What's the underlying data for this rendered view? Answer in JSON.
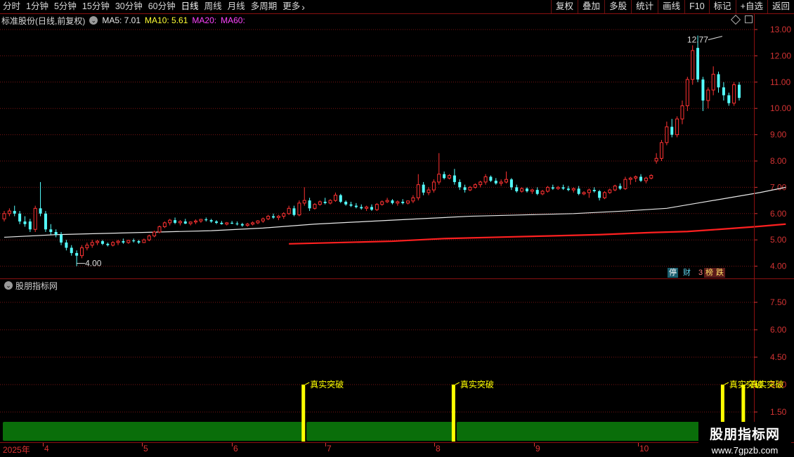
{
  "toolbar": {
    "periods": [
      "分时",
      "1分钟",
      "5分钟",
      "15分钟",
      "30分钟",
      "60分钟",
      "日线",
      "周线",
      "月线",
      "多周期",
      "更多"
    ],
    "active_period": "日线",
    "right_buttons": [
      "复权",
      "叠加",
      "多股",
      "统计",
      "画线",
      "F10",
      "标记",
      "+自选",
      "返回"
    ]
  },
  "info": {
    "stock": "标准股份(日线,前复权)",
    "ma5": "MA5: 7.01",
    "ma10": "MA10: 5.61",
    "ma20": "MA20:",
    "ma60": "MA60:"
  },
  "colors": {
    "up": "#ff3232",
    "down": "#54ffff",
    "ma_white": "#e8e8e8",
    "ma_red": "#ff2020",
    "signal_yellow": "#ffff00",
    "band_green": "#0a6e0a",
    "axis_red": "#d33333"
  },
  "price_axis": [
    "13.00",
    "12.00",
    "11.00",
    "10.00",
    "9.00",
    "8.00",
    "7.00",
    "6.00",
    "5.00",
    "4.00"
  ],
  "annotations": {
    "high": "12.77",
    "low": "4.00"
  },
  "badges": [
    "停",
    "财",
    "3",
    "榜",
    "跌"
  ],
  "indicator": {
    "title": "股朋指标网",
    "axis": [
      "7.50",
      "6.00",
      "4.50",
      "3.00",
      "1.50"
    ],
    "signal_label": "真实突破"
  },
  "x_axis": [
    "2025年",
    "4",
    "5",
    "6",
    "7",
    "8",
    "9",
    "10"
  ],
  "watermark": {
    "title": "股朋指标网",
    "url": "www.7gpzb.com"
  },
  "chart_data": {
    "type": "candlestick",
    "ylim": [
      3.6,
      13.2
    ],
    "candles": [
      [
        5.8,
        6.1,
        5.7,
        6.0
      ],
      [
        6.0,
        6.2,
        5.9,
        6.1
      ],
      [
        6.1,
        6.3,
        5.9,
        6.0
      ],
      [
        6.0,
        6.1,
        5.6,
        5.7
      ],
      [
        5.7,
        5.9,
        5.5,
        5.6
      ],
      [
        5.7,
        5.8,
        5.3,
        5.4
      ],
      [
        5.4,
        6.3,
        5.3,
        6.2
      ],
      [
        6.2,
        7.2,
        5.9,
        6.0
      ],
      [
        6.0,
        6.1,
        5.3,
        5.4
      ],
      [
        5.4,
        5.6,
        5.2,
        5.3
      ],
      [
        5.3,
        5.4,
        5.1,
        5.2
      ],
      [
        5.2,
        5.3,
        4.8,
        4.9
      ],
      [
        4.9,
        5.0,
        4.6,
        4.7
      ],
      [
        4.7,
        4.8,
        4.4,
        4.5
      ],
      [
        4.5,
        4.6,
        4.0,
        4.4
      ],
      [
        4.4,
        4.8,
        4.3,
        4.7
      ],
      [
        4.7,
        4.9,
        4.6,
        4.8
      ],
      [
        4.8,
        5.0,
        4.7,
        4.9
      ],
      [
        4.9,
        5.0,
        4.8,
        4.95
      ],
      [
        4.95,
        5.0,
        4.8,
        4.85
      ],
      [
        4.85,
        4.9,
        4.75,
        4.8
      ],
      [
        4.8,
        4.95,
        4.75,
        4.9
      ],
      [
        4.9,
        5.0,
        4.8,
        4.95
      ],
      [
        4.95,
        5.05,
        4.85,
        4.9
      ],
      [
        4.9,
        5.0,
        4.85,
        4.98
      ],
      [
        4.98,
        5.05,
        4.9,
        4.95
      ],
      [
        4.95,
        5.0,
        4.85,
        4.9
      ],
      [
        4.9,
        5.05,
        4.88,
        5.0
      ],
      [
        5.0,
        5.2,
        4.95,
        5.15
      ],
      [
        5.15,
        5.35,
        5.1,
        5.3
      ],
      [
        5.3,
        5.55,
        5.25,
        5.5
      ],
      [
        5.5,
        5.7,
        5.45,
        5.65
      ],
      [
        5.65,
        5.8,
        5.55,
        5.75
      ],
      [
        5.75,
        5.85,
        5.6,
        5.65
      ],
      [
        5.65,
        5.75,
        5.55,
        5.7
      ],
      [
        5.7,
        5.8,
        5.6,
        5.62
      ],
      [
        5.62,
        5.7,
        5.55,
        5.68
      ],
      [
        5.68,
        5.78,
        5.6,
        5.72
      ],
      [
        5.72,
        5.8,
        5.65,
        5.78
      ],
      [
        5.78,
        5.85,
        5.7,
        5.75
      ],
      [
        5.75,
        5.8,
        5.65,
        5.7
      ],
      [
        5.7,
        5.75,
        5.6,
        5.65
      ],
      [
        5.65,
        5.72,
        5.58,
        5.6
      ],
      [
        5.6,
        5.68,
        5.55,
        5.65
      ],
      [
        5.65,
        5.72,
        5.6,
        5.62
      ],
      [
        5.62,
        5.7,
        5.55,
        5.6
      ],
      [
        5.6,
        5.65,
        5.5,
        5.55
      ],
      [
        5.55,
        5.65,
        5.5,
        5.6
      ],
      [
        5.6,
        5.7,
        5.55,
        5.65
      ],
      [
        5.65,
        5.75,
        5.6,
        5.72
      ],
      [
        5.72,
        5.85,
        5.65,
        5.8
      ],
      [
        5.8,
        5.95,
        5.75,
        5.9
      ],
      [
        5.9,
        6.0,
        5.8,
        5.85
      ],
      [
        5.85,
        5.95,
        5.75,
        5.9
      ],
      [
        5.9,
        6.05,
        5.8,
        6.0
      ],
      [
        6.0,
        6.3,
        5.95,
        6.2
      ],
      [
        6.2,
        6.3,
        5.9,
        5.95
      ],
      [
        5.95,
        6.5,
        5.9,
        6.4
      ],
      [
        6.4,
        7.0,
        6.3,
        6.5
      ],
      [
        6.5,
        6.6,
        6.1,
        6.2
      ],
      [
        6.2,
        6.4,
        6.15,
        6.35
      ],
      [
        6.35,
        6.5,
        6.3,
        6.45
      ],
      [
        6.45,
        6.6,
        6.35,
        6.4
      ],
      [
        6.4,
        6.55,
        6.35,
        6.5
      ],
      [
        6.5,
        6.8,
        6.45,
        6.7
      ],
      [
        6.7,
        6.75,
        6.4,
        6.45
      ],
      [
        6.45,
        6.5,
        6.3,
        6.35
      ],
      [
        6.35,
        6.45,
        6.25,
        6.3
      ],
      [
        6.3,
        6.4,
        6.2,
        6.25
      ],
      [
        6.25,
        6.35,
        6.15,
        6.2
      ],
      [
        6.2,
        6.3,
        6.1,
        6.25
      ],
      [
        6.25,
        6.35,
        6.1,
        6.15
      ],
      [
        6.15,
        6.4,
        6.1,
        6.35
      ],
      [
        6.35,
        6.5,
        6.3,
        6.45
      ],
      [
        6.45,
        6.6,
        6.4,
        6.5
      ],
      [
        6.5,
        6.55,
        6.35,
        6.4
      ],
      [
        6.4,
        6.5,
        6.3,
        6.45
      ],
      [
        6.45,
        6.55,
        6.35,
        6.4
      ],
      [
        6.4,
        6.5,
        6.35,
        6.48
      ],
      [
        6.48,
        6.7,
        6.4,
        6.6
      ],
      [
        6.6,
        7.5,
        6.5,
        7.1
      ],
      [
        7.1,
        7.2,
        6.7,
        6.8
      ],
      [
        6.8,
        7.0,
        6.7,
        6.9
      ],
      [
        6.9,
        7.3,
        6.8,
        7.2
      ],
      [
        7.2,
        8.3,
        7.1,
        7.5
      ],
      [
        7.5,
        7.6,
        7.3,
        7.35
      ],
      [
        7.35,
        7.5,
        7.3,
        7.45
      ],
      [
        7.45,
        7.7,
        7.1,
        7.2
      ],
      [
        7.2,
        7.3,
        6.9,
        7.0
      ],
      [
        7.0,
        7.1,
        6.8,
        6.9
      ],
      [
        6.9,
        7.05,
        6.85,
        7.0
      ],
      [
        7.0,
        7.15,
        6.95,
        7.1
      ],
      [
        7.1,
        7.25,
        7.0,
        7.2
      ],
      [
        7.2,
        7.5,
        7.1,
        7.4
      ],
      [
        7.4,
        7.45,
        7.2,
        7.25
      ],
      [
        7.25,
        7.35,
        7.1,
        7.15
      ],
      [
        7.15,
        7.3,
        7.05,
        7.2
      ],
      [
        7.2,
        7.6,
        7.15,
        7.3
      ],
      [
        7.3,
        7.35,
        6.9,
        7.0
      ],
      [
        7.0,
        7.1,
        6.8,
        6.85
      ],
      [
        6.85,
        7.0,
        6.8,
        6.95
      ],
      [
        6.95,
        7.0,
        6.8,
        6.85
      ],
      [
        6.85,
        6.95,
        6.75,
        6.9
      ],
      [
        6.9,
        7.0,
        6.7,
        6.75
      ],
      [
        6.75,
        6.9,
        6.7,
        6.85
      ],
      [
        6.85,
        7.05,
        6.8,
        7.0
      ],
      [
        7.0,
        7.1,
        6.9,
        6.95
      ],
      [
        6.95,
        7.05,
        6.9,
        7.0
      ],
      [
        7.0,
        7.1,
        6.9,
        6.95
      ],
      [
        6.95,
        7.05,
        6.85,
        6.9
      ],
      [
        6.9,
        7.0,
        6.8,
        6.95
      ],
      [
        6.95,
        7.05,
        6.7,
        6.75
      ],
      [
        6.75,
        6.85,
        6.7,
        6.8
      ],
      [
        6.8,
        6.95,
        6.6,
        6.9
      ],
      [
        6.9,
        7.0,
        6.8,
        6.85
      ],
      [
        6.85,
        6.9,
        6.5,
        6.6
      ],
      [
        6.6,
        6.85,
        6.55,
        6.8
      ],
      [
        6.8,
        6.95,
        6.75,
        6.9
      ],
      [
        6.9,
        7.1,
        6.85,
        7.05
      ],
      [
        7.05,
        7.15,
        6.9,
        6.95
      ],
      [
        6.95,
        7.4,
        6.9,
        7.3
      ],
      [
        7.3,
        7.4,
        7.1,
        7.35
      ],
      [
        7.35,
        7.45,
        7.2,
        7.4
      ],
      [
        7.4,
        7.5,
        7.2,
        7.25
      ],
      [
        7.25,
        7.4,
        7.15,
        7.35
      ],
      [
        7.35,
        7.5,
        7.3,
        7.45
      ],
      [
        8.0,
        8.3,
        7.9,
        8.1
      ],
      [
        8.1,
        8.8,
        8.0,
        8.7
      ],
      [
        8.7,
        9.5,
        8.6,
        9.3
      ],
      [
        9.3,
        9.6,
        8.9,
        9.0
      ],
      [
        9.0,
        9.7,
        8.9,
        9.6
      ],
      [
        9.6,
        10.3,
        9.4,
        10.1
      ],
      [
        10.1,
        11.2,
        9.9,
        11.1
      ],
      [
        11.1,
        12.4,
        10.9,
        12.2
      ],
      [
        12.3,
        12.77,
        11.0,
        11.1
      ],
      [
        11.1,
        11.2,
        9.9,
        10.3
      ],
      [
        10.3,
        10.8,
        10.0,
        10.7
      ],
      [
        10.7,
        11.6,
        10.5,
        11.3
      ],
      [
        11.3,
        11.4,
        10.6,
        10.8
      ],
      [
        10.8,
        11.0,
        10.3,
        10.5
      ],
      [
        10.5,
        10.6,
        10.1,
        10.2
      ],
      [
        10.2,
        11.0,
        10.1,
        10.9
      ],
      [
        10.9,
        11.0,
        10.3,
        10.4
      ]
    ],
    "ma_white": [
      [
        0,
        5.1
      ],
      [
        10,
        5.2
      ],
      [
        20,
        5.25
      ],
      [
        30,
        5.3
      ],
      [
        40,
        5.35
      ],
      [
        50,
        5.45
      ],
      [
        60,
        5.6
      ],
      [
        70,
        5.7
      ],
      [
        80,
        5.8
      ],
      [
        90,
        5.9
      ],
      [
        100,
        5.95
      ],
      [
        110,
        6.0
      ],
      [
        120,
        6.1
      ],
      [
        128,
        6.2
      ],
      [
        134,
        6.4
      ],
      [
        140,
        6.6
      ],
      [
        146,
        6.8
      ],
      [
        151,
        7.0
      ]
    ],
    "ma_red": [
      [
        55,
        4.85
      ],
      [
        65,
        4.9
      ],
      [
        75,
        4.95
      ],
      [
        85,
        5.05
      ],
      [
        95,
        5.1
      ],
      [
        105,
        5.15
      ],
      [
        115,
        5.2
      ],
      [
        125,
        5.28
      ],
      [
        132,
        5.32
      ],
      [
        138,
        5.4
      ],
      [
        145,
        5.5
      ],
      [
        151,
        5.6
      ]
    ],
    "signals": [
      58,
      87,
      139,
      143
    ],
    "band_gaps": [
      58,
      87,
      139,
      141
    ]
  }
}
